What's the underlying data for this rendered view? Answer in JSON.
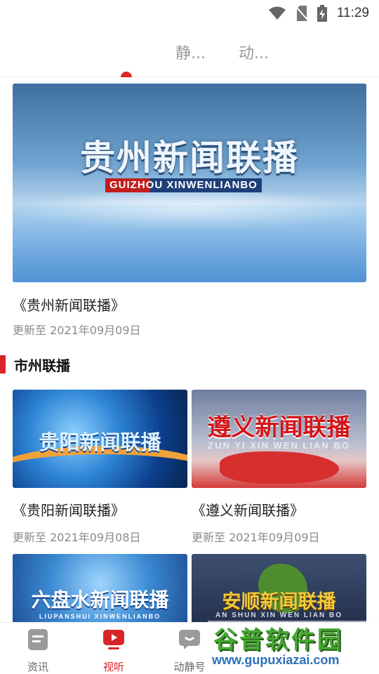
{
  "status_bar": {
    "time": "11:29"
  },
  "top_tabs": [
    {
      "label": "静..."
    },
    {
      "label": "动..."
    }
  ],
  "hero": {
    "banner_title": "贵州新闻联播",
    "banner_subtitle": "GUIZHOU XINWENLIANBO",
    "title": "《贵州新闻联播》",
    "updated": "更新至 2021年09月09日"
  },
  "section": {
    "title": "市州联播"
  },
  "cards": [
    {
      "thumb_text": "贵阳新闻联播",
      "thumb_sub": "",
      "title": "《贵阳新闻联播》",
      "updated": "更新至 2021年09月08日"
    },
    {
      "thumb_text": "遵义新闻联播",
      "thumb_sub": "ZUN YI XIN WEN LIAN BO",
      "title": "《遵义新闻联播》",
      "updated": "更新至 2021年09月09日"
    },
    {
      "thumb_text": "六盘水新闻联播",
      "thumb_sub": "LIUPANSHUI XINWENLIANBO"
    },
    {
      "thumb_text": "安顺新闻联播",
      "thumb_sub": "AN SHUN XIN WEN LIAN BO"
    }
  ],
  "bottom_tabs": [
    {
      "label": "资讯",
      "icon": "news-doc-icon"
    },
    {
      "label": "视听",
      "icon": "play-video-icon",
      "active": true
    },
    {
      "label": "动静号",
      "icon": "chat-bubble-icon"
    }
  ],
  "watermark": {
    "text": "谷普软件园",
    "url": "www.gupuxiazai.com"
  },
  "colors": {
    "accent": "#d9242a"
  }
}
